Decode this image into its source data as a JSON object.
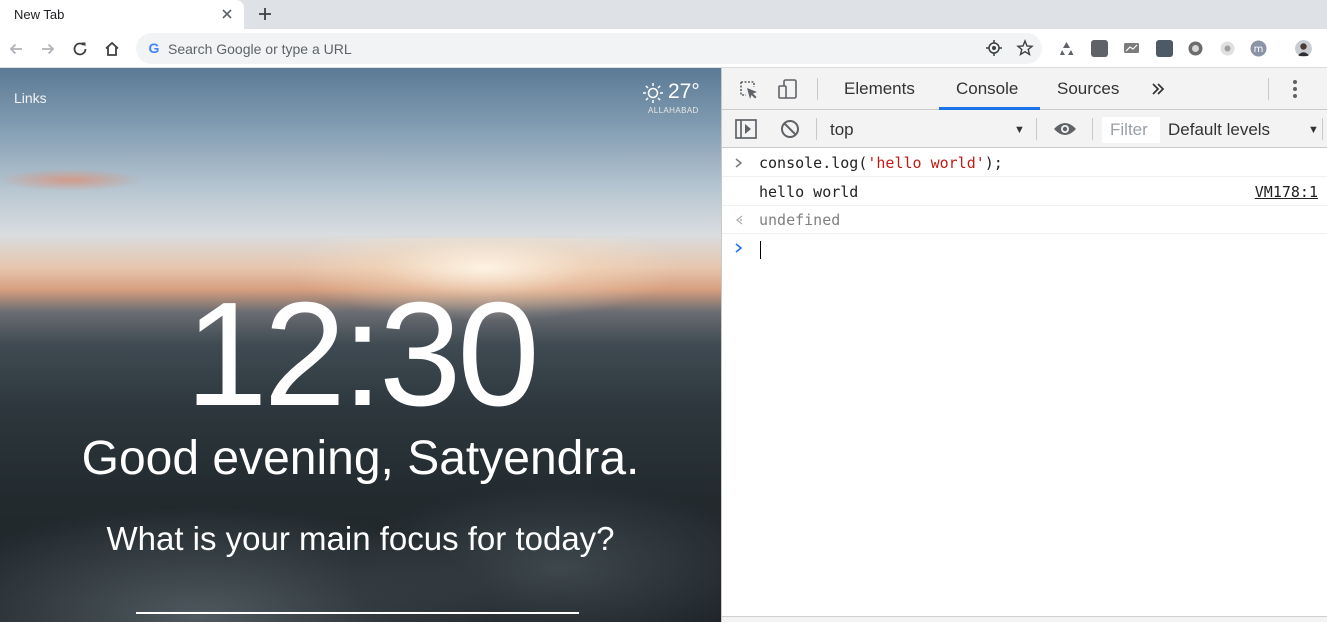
{
  "browser": {
    "tab": {
      "title": "New Tab"
    },
    "omnibox": {
      "placeholder": "Search Google or type a URL"
    }
  },
  "page": {
    "links_label": "Links",
    "weather": {
      "temperature": "27°",
      "city": "ALLAHABAD"
    },
    "clock": "12:30",
    "greeting": "Good evening, Satyendra.",
    "focus_question": "What is your main focus for today?"
  },
  "devtools": {
    "tabs": [
      {
        "label": "Elements"
      },
      {
        "label": "Console"
      },
      {
        "label": "Sources"
      }
    ],
    "active_tab": "Console",
    "context": "top",
    "filter_placeholder": "Filter",
    "levels": "Default levels",
    "console": {
      "input_prefix": "console.log(",
      "input_string": "'hello world'",
      "input_suffix": ");",
      "output": "hello world",
      "source_link": "VM178:1",
      "return_value": "undefined"
    }
  },
  "colors": {
    "accent": "#1a73e8",
    "console_string": "#c41a16"
  }
}
